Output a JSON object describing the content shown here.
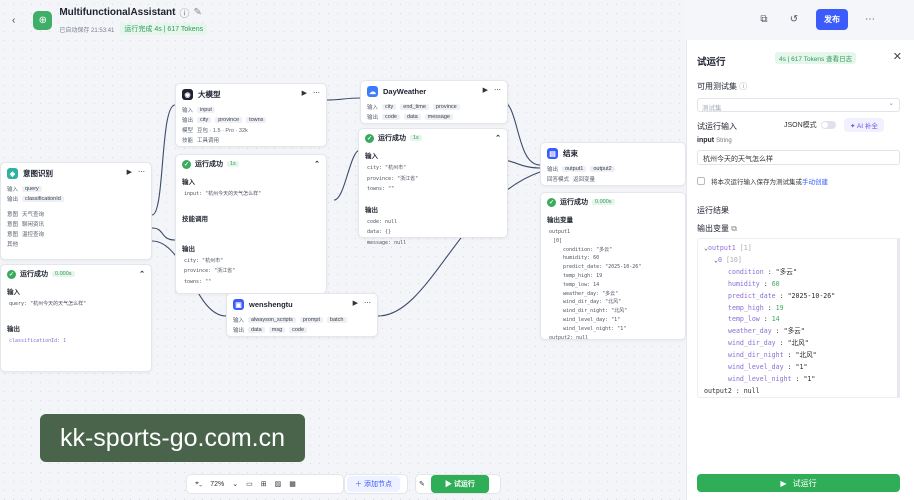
{
  "app": {
    "title": "MultifunctionalAssistant",
    "saved": "已自动保存 21:53:41",
    "run_status": "运行完成 4s | 617 Tokens",
    "publish": "发布"
  },
  "nodes": {
    "intent": {
      "title": "意图识别",
      "in_label": "输入",
      "in_var": "query",
      "out_label": "输出",
      "out_var": "classificationId",
      "opt1_label": "意图",
      "opt1": "天气查询",
      "opt2_label": "意图",
      "opt2": "聊闲资讯",
      "opt3_label": "意图",
      "opt3": "温控查询",
      "other": "其他",
      "ok": "运行成功",
      "time": "0.000s",
      "sec_in": "输入",
      "sec_out": "输出",
      "query_val": "query: \"杭州今天的天气怎么样\"",
      "cls_val": "classificationId: 1"
    },
    "llm": {
      "title": "大模型",
      "in_label": "输入",
      "in_var": "input",
      "out_label": "输出",
      "v1": "city",
      "v2": "province",
      "v3": "towns",
      "model_label": "模型",
      "model": "豆包 · 1.5 · Pro · 32k",
      "skill_label": "技能",
      "skill": "工具调用",
      "ok": "运行成功",
      "time": "1s",
      "sec_in": "输入",
      "in_val": "input: \"杭州今天的天气怎么样\"",
      "sec_skill": "技能调用",
      "sec_out": "输出",
      "o1": "city: \"杭州市\"",
      "o2": "province: \"浙江省\"",
      "o3": "towns: \"\""
    },
    "weather": {
      "title": "DayWeather",
      "in_label": "输入",
      "i1": "city",
      "i2": "end_time",
      "i3": "province",
      "out_label": "输出",
      "o1": "code",
      "o2": "data",
      "o3": "message",
      "ok": "运行成功",
      "time": "1s",
      "sec_in": "输入",
      "v1": "city: \"杭州市\"",
      "v2": "province: \"浙江省\"",
      "v3": "towns: \"\"",
      "sec_out": "输出",
      "r1": "code: null",
      "r2": "data: {}",
      "r3": "message: null"
    },
    "wensheng": {
      "title": "wenshengtu",
      "in_label": "输入",
      "i1": "alwayson_scripts",
      "i2": "prompt",
      "i3": "batch",
      "out_label": "输出",
      "o1": "data",
      "o2": "msg",
      "o3": "code"
    },
    "end": {
      "title": "结束",
      "out_label": "输出",
      "o1": "output1",
      "o2": "output2",
      "mode_label": "回答模式",
      "mode": "返回变量",
      "ok": "运行成功",
      "time": "0.000s",
      "sec": "输出变量",
      "lines": [
        "output1",
        "[0]",
        "condition: \"多云\"",
        "humidity: 60",
        "predict_date: \"2025-10-26\"",
        "temp_high: 19",
        "temp_low: 14",
        "weather_day: \"多云\"",
        "wind_dir_day: \"北风\"",
        "wind_dir_night: \"北风\"",
        "wind_level_day: \"1\"",
        "wind_level_night: \"1\"",
        "output2: null"
      ]
    }
  },
  "toolbar": {
    "zoom": "72%",
    "add_node": "添加节点",
    "run": "试运行"
  },
  "panel": {
    "title": "试运行",
    "pill": "4s | 617 Tokens  查看日志",
    "dataset_label": "可用测试集",
    "dataset_placeholder": "测试集",
    "input_label": "试运行输入",
    "json_mode": "JSON模式",
    "ai_fill": "AI 补全",
    "input_name": "input",
    "input_type": "String",
    "input_value": "杭州今天的天气怎么样",
    "save_text": "将本次运行输入保存为测试集或",
    "save_link": "手动创建",
    "result_label": "运行结果",
    "output_label": "输出变量",
    "run_button": "试运行"
  },
  "result_tree": {
    "root": "output1",
    "root_note": "[1]",
    "idx": "0",
    "idx_note": "[10]",
    "items": [
      {
        "k": "condition",
        "v": "\"多云\""
      },
      {
        "k": "humidity",
        "v": "60"
      },
      {
        "k": "predict_date",
        "v": "\"2025-10-26\""
      },
      {
        "k": "temp_high",
        "v": "19"
      },
      {
        "k": "temp_low",
        "v": "14"
      },
      {
        "k": "weather_day",
        "v": "\"多云\""
      },
      {
        "k": "wind_dir_day",
        "v": "\"北风\""
      },
      {
        "k": "wind_dir_night",
        "v": "\"北风\""
      },
      {
        "k": "wind_level_day",
        "v": "\"1\""
      },
      {
        "k": "wind_level_night",
        "v": "\"1\""
      }
    ],
    "tail": "output2 : null"
  },
  "watermark": "kk-sports-go.com.cn"
}
